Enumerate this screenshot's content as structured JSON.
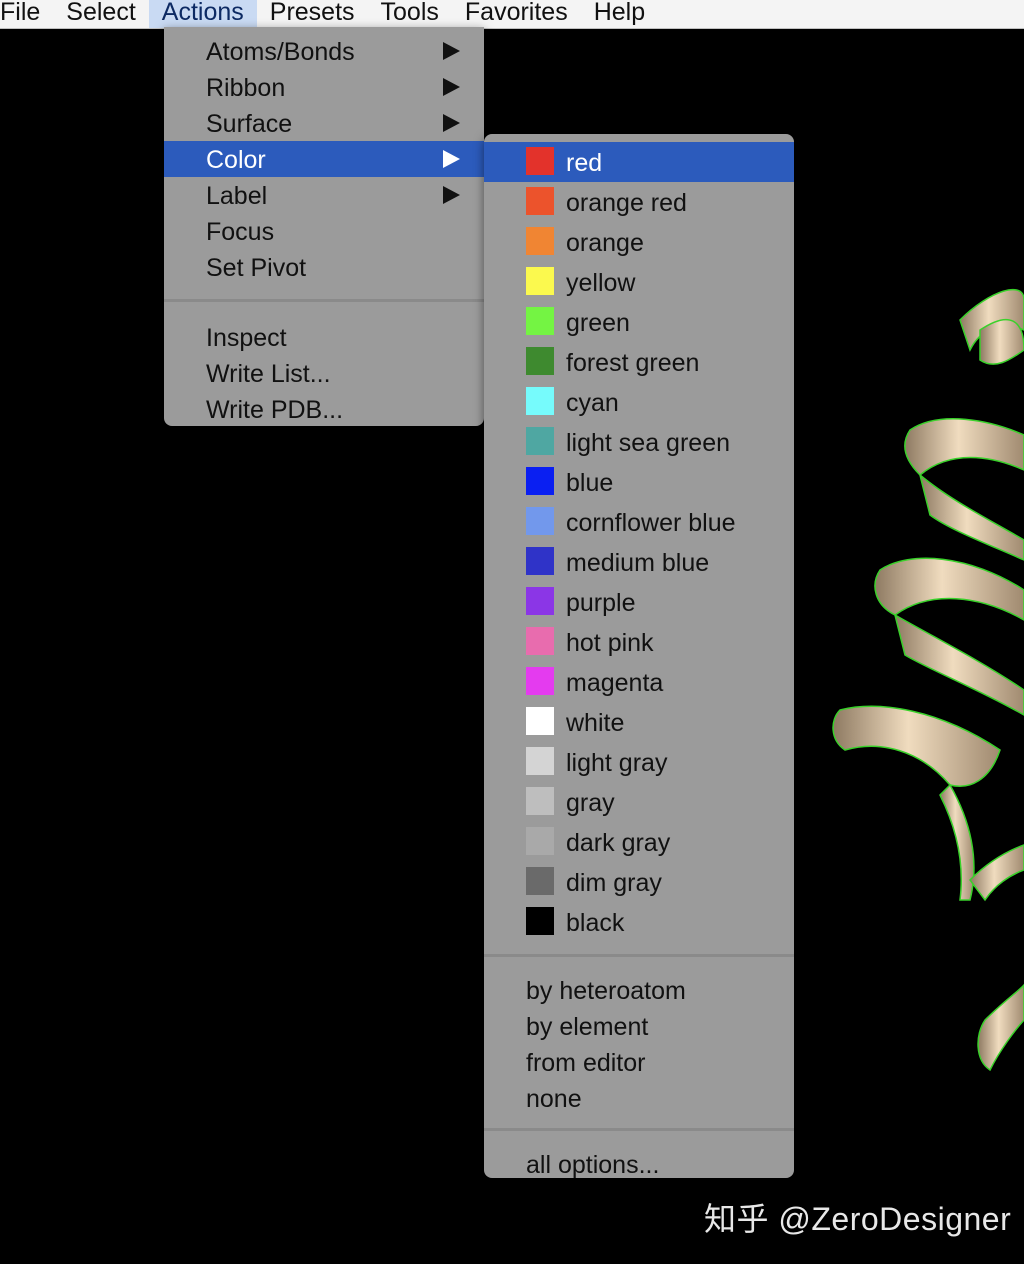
{
  "menubar": {
    "items": [
      "File",
      "Select",
      "Actions",
      "Presets",
      "Tools",
      "Favorites",
      "Help"
    ],
    "active_index": 2
  },
  "actions_menu": {
    "items": [
      {
        "label": "Atoms/Bonds",
        "submenu": true
      },
      {
        "label": "Ribbon",
        "submenu": true
      },
      {
        "label": "Surface",
        "submenu": true
      },
      {
        "label": "Color",
        "submenu": true,
        "highlighted": true
      },
      {
        "label": "Label",
        "submenu": true
      },
      {
        "label": "Focus",
        "submenu": false
      },
      {
        "label": "Set Pivot",
        "submenu": false
      }
    ],
    "items2": [
      {
        "label": "Inspect"
      },
      {
        "label": "Write List..."
      },
      {
        "label": "Write PDB..."
      }
    ]
  },
  "color_menu": {
    "colors": [
      {
        "label": "red",
        "hex": "#e3322b",
        "highlighted": true
      },
      {
        "label": "orange red",
        "hex": "#ec532c"
      },
      {
        "label": "orange",
        "hex": "#f08533"
      },
      {
        "label": "yellow",
        "hex": "#fbf94e"
      },
      {
        "label": "green",
        "hex": "#74f443"
      },
      {
        "label": "forest green",
        "hex": "#3e8a2f"
      },
      {
        "label": "cyan",
        "hex": "#76fbfc"
      },
      {
        "label": "light sea green",
        "hex": "#4fa7a2"
      },
      {
        "label": "blue",
        "hex": "#0a1ff2"
      },
      {
        "label": "cornflower blue",
        "hex": "#7298ec"
      },
      {
        "label": "medium blue",
        "hex": "#2f33c8"
      },
      {
        "label": "purple",
        "hex": "#8b36e6"
      },
      {
        "label": "hot pink",
        "hex": "#e86cae"
      },
      {
        "label": "magenta",
        "hex": "#e43bef"
      },
      {
        "label": "white",
        "hex": "#ffffff"
      },
      {
        "label": "light gray",
        "hex": "#d4d4d4"
      },
      {
        "label": "gray",
        "hex": "#bebebe"
      },
      {
        "label": "dark gray",
        "hex": "#a9a9a9"
      },
      {
        "label": "dim gray",
        "hex": "#6a6a6a"
      },
      {
        "label": "black",
        "hex": "#000000"
      }
    ],
    "options": [
      "by heteroatom",
      "by element",
      "from editor",
      "none"
    ],
    "all_options": "all options..."
  },
  "watermark": "知乎 @ZeroDesigner",
  "colors": {
    "menu_bg": "#9b9b9b",
    "highlight": "#2c5bbc",
    "ribbon": "#d9c3a3",
    "ribbon_outline": "#39d12a"
  }
}
